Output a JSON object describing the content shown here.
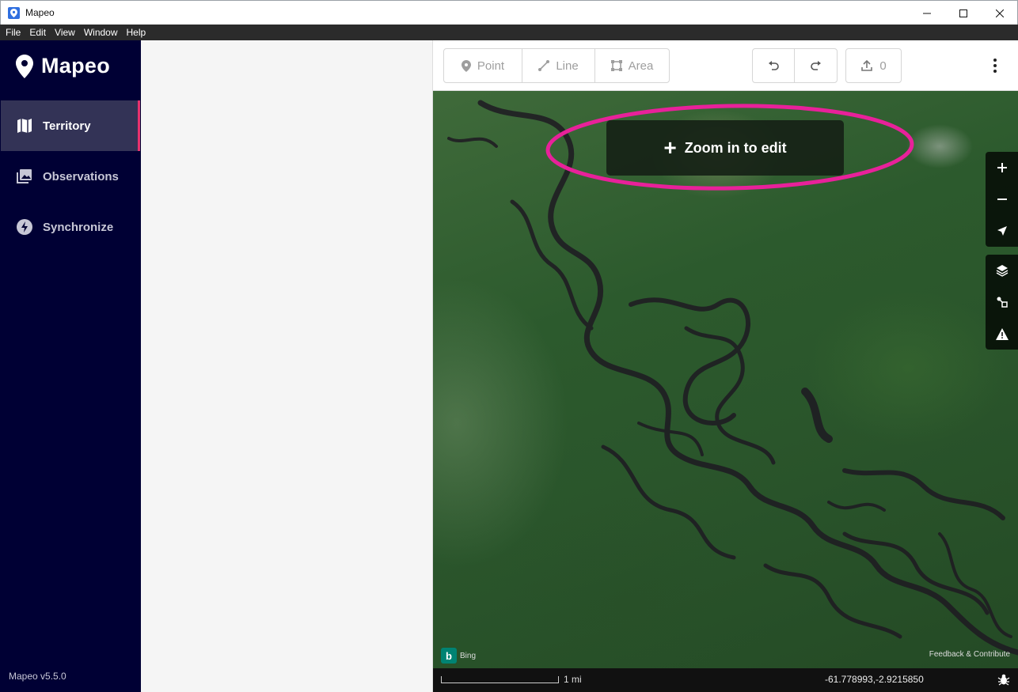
{
  "window": {
    "title": "Mapeo"
  },
  "menu": [
    "File",
    "Edit",
    "View",
    "Window",
    "Help"
  ],
  "sidebar": {
    "logo_text": "Mapeo",
    "items": [
      {
        "label": "Territory",
        "icon": "map-icon",
        "active": true
      },
      {
        "label": "Observations",
        "icon": "photo-icon",
        "active": false
      },
      {
        "label": "Synchronize",
        "icon": "lightning-icon",
        "active": false
      }
    ],
    "version": "Mapeo v5.5.0"
  },
  "toolbar": {
    "point_label": "Point",
    "line_label": "Line",
    "area_label": "Area",
    "upload_count": "0"
  },
  "map": {
    "zoom_banner": "Zoom in to edit",
    "bing_label": "Bing",
    "feedback_link": "Feedback & Contribute",
    "scale_label": "1 mi",
    "coordinates": "-61.778993,-2.9215850"
  },
  "colors": {
    "sidebar_bg": "#000034",
    "active_bg": "#333356",
    "active_accent": "#e8326e",
    "annotation": "#e8219a"
  }
}
